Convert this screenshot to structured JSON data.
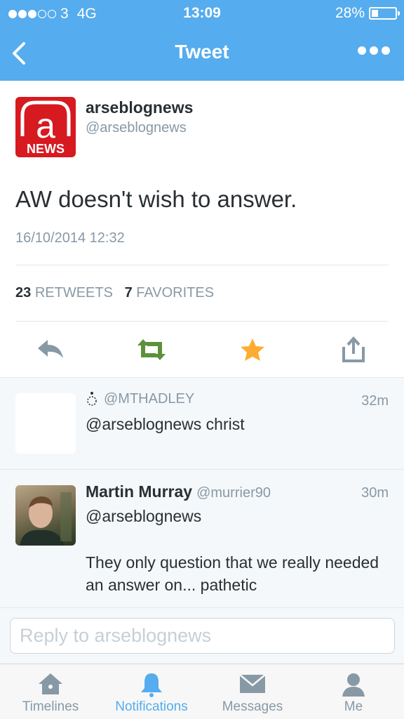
{
  "status_bar": {
    "carrier": "3",
    "network": "4G",
    "time": "13:09",
    "battery": "28%",
    "battery_level": 0.28
  },
  "nav": {
    "title": "Tweet",
    "back_icon": "chevron-left-icon",
    "more_icon": "more-dots-icon"
  },
  "tweet": {
    "logo_text": "a",
    "logo_subtext": "NEWS",
    "display_name": "arseblognews",
    "handle": "@arseblognews",
    "text": "AW doesn't wish to answer.",
    "timestamp": "16/10/2014 12:32",
    "retweets_count": "23",
    "retweets_label": "RETWEETS",
    "favorites_count": "7",
    "favorites_label": "FAVORITES",
    "actions": [
      "reply-icon",
      "retweet-icon",
      "favorite-star-icon",
      "share-icon"
    ]
  },
  "replies": [
    {
      "name": "",
      "handle": "@MTHADLEY",
      "time": "32m",
      "text": "@arseblognews christ"
    },
    {
      "name": "Martin Murray",
      "handle": "@murrier90",
      "time": "30m",
      "text_line1": "@arseblognews",
      "text_body": "They only question that we really needed an answer on... pathetic"
    }
  ],
  "reply_box": {
    "placeholder": "Reply to arseblognews"
  },
  "tabbar": {
    "tabs": [
      {
        "label": "Timelines",
        "icon": "home-icon",
        "active": false
      },
      {
        "label": "Notifications",
        "icon": "bell-icon",
        "active": true
      },
      {
        "label": "Messages",
        "icon": "envelope-icon",
        "active": false
      },
      {
        "label": "Me",
        "icon": "person-icon",
        "active": false
      }
    ]
  },
  "colors": {
    "brand": "#55acee",
    "retweet": "#5c913b",
    "star": "#ffac33",
    "logo_red": "#d71920",
    "text": "#292f33",
    "muted": "#8899a6"
  }
}
